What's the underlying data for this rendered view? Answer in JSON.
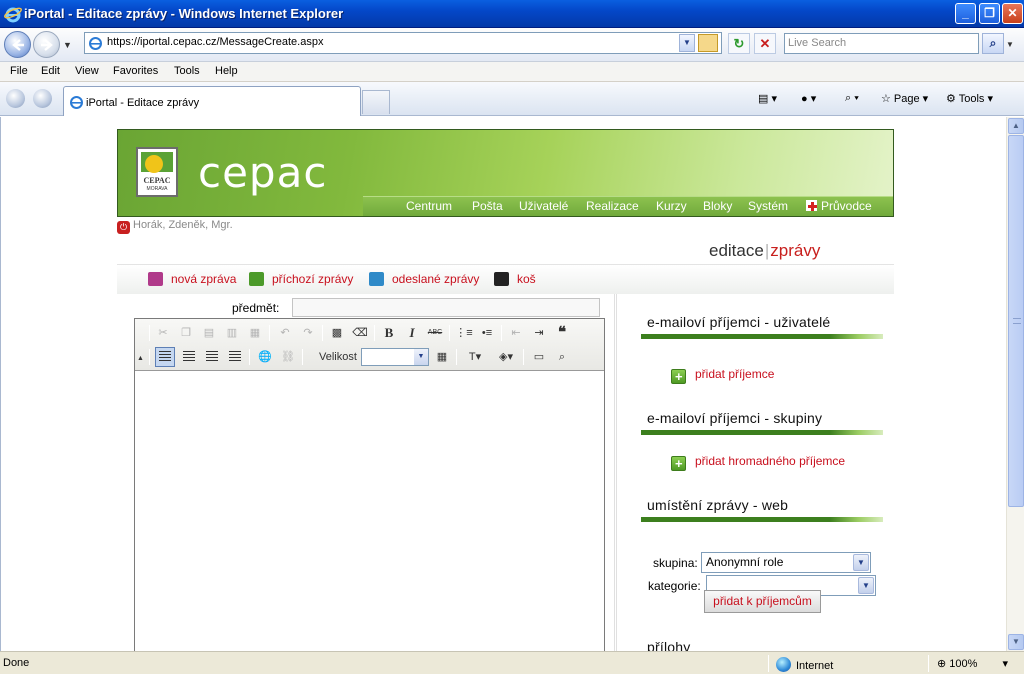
{
  "window": {
    "title": "iPortal - Editace zprávy - Windows Internet Explorer",
    "url": "https://iportal.cepac.cz/MessageCreate.aspx",
    "search_placeholder": "Live Search"
  },
  "menu": [
    "File",
    "Edit",
    "View",
    "Favorites",
    "Tools",
    "Help"
  ],
  "tab": {
    "label": "iPortal - Editace zprávy"
  },
  "commandbar": {
    "page_label": "Page",
    "tools_label": "Tools"
  },
  "site": {
    "logo_name": "CEPAC",
    "logo_sub": "MORAVA",
    "brand": "cepac",
    "nav": [
      "Centrum",
      "Pošta",
      "Uživatelé",
      "Realizace",
      "Kurzy",
      "Bloky",
      "Systém",
      "Průvodce"
    ],
    "user": "Horák, Zdeněk, Mgr."
  },
  "page": {
    "title_part1": "editace",
    "title_separator": "|",
    "title_part2": "zprávy"
  },
  "actions": [
    {
      "label": "nová zpráva",
      "icon": "envelope-icon",
      "color": "#b03a8a"
    },
    {
      "label": "příchozí zprávy",
      "icon": "inbox-icon",
      "color": "#4c9a2a"
    },
    {
      "label": "odeslané zprávy",
      "icon": "sent-icon",
      "color": "#2f8ac8"
    },
    {
      "label": "koš",
      "icon": "trash-icon",
      "color": "#222222"
    }
  ],
  "form": {
    "subject_label": "předmět:",
    "subject_value": ""
  },
  "editor": {
    "size_label": "Velikost",
    "size_value": ""
  },
  "sections": {
    "users": {
      "title": "e-mailoví příjemci - uživatelé",
      "add_label": "přidat příjemce"
    },
    "groups": {
      "title": "e-mailoví příjemci - skupiny",
      "add_label": "přidat hromadného příjemce"
    },
    "web": {
      "title": "umístění zprávy - web",
      "group_label": "skupina:",
      "group_value": "Anonymní role",
      "category_label": "kategorie:",
      "category_value": "",
      "submit_label": "přidat k příjemcům"
    },
    "attachments": {
      "title": "přílohy"
    }
  },
  "status": {
    "left": "Done",
    "zone": "Internet",
    "zoom": "100%"
  }
}
